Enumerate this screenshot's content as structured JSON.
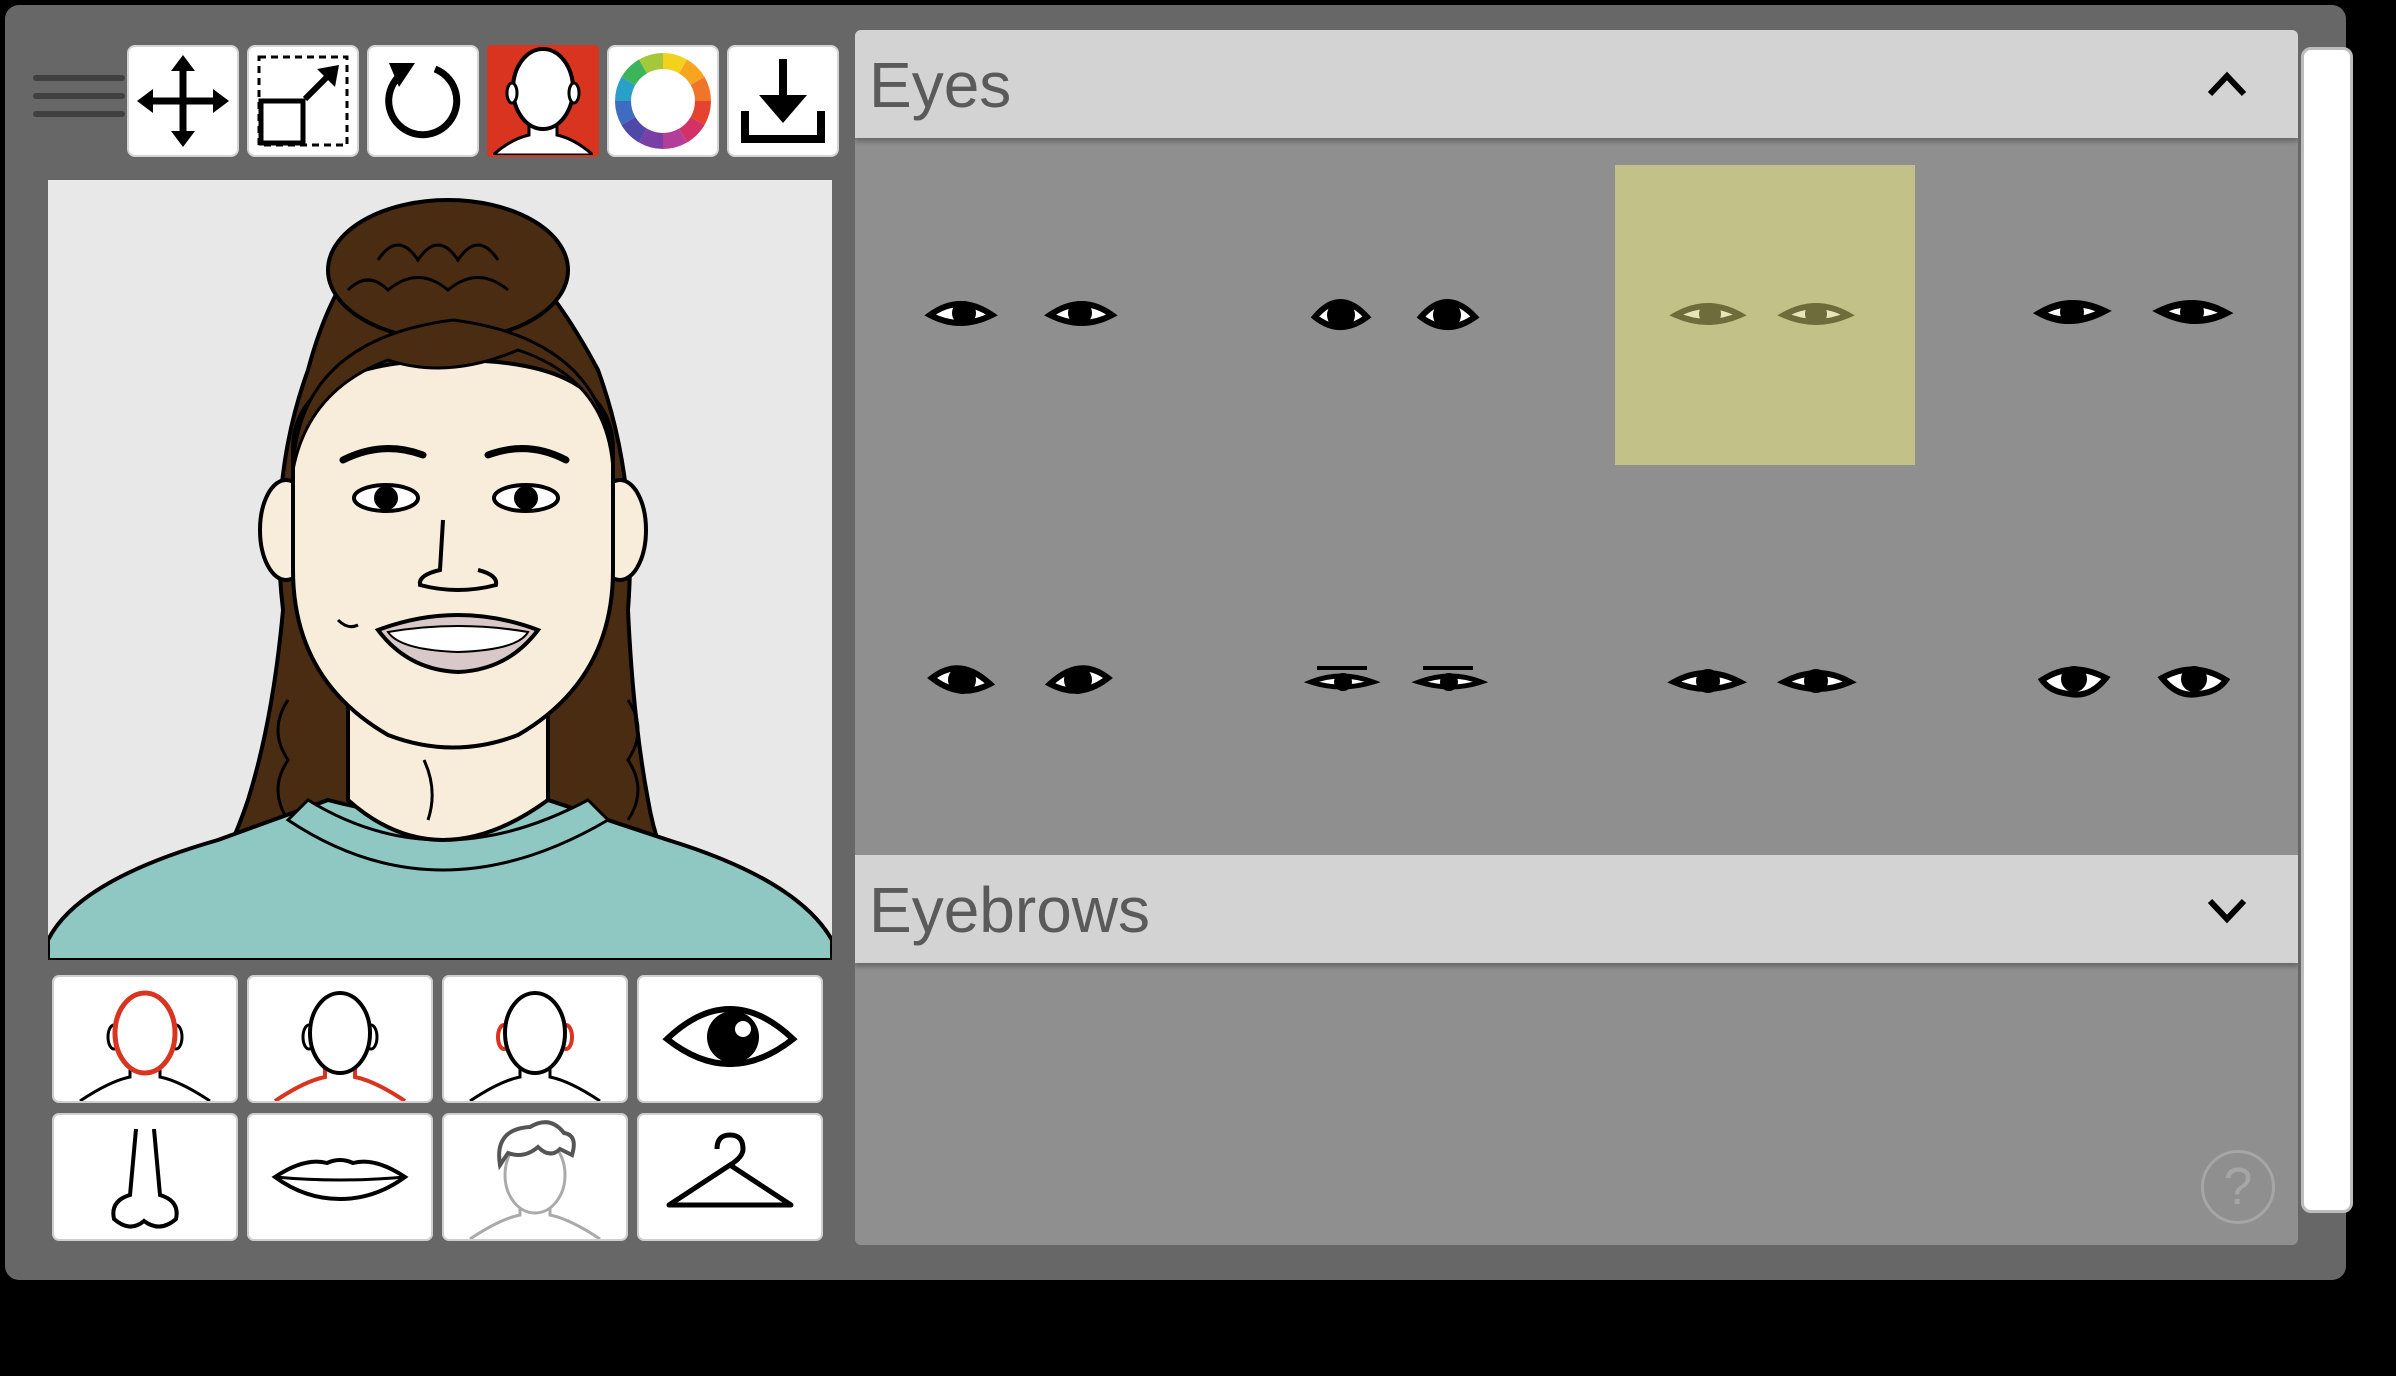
{
  "toolbar": {
    "buttons": [
      {
        "name": "move-tool-button",
        "icon": "move-arrows-icon"
      },
      {
        "name": "resize-tool-button",
        "icon": "resize-icon"
      },
      {
        "name": "reset-button",
        "icon": "reset-icon"
      },
      {
        "name": "face-shape-button",
        "icon": "head-icon",
        "active": true
      },
      {
        "name": "color-button",
        "icon": "color-wheel-icon"
      },
      {
        "name": "download-button",
        "icon": "download-icon"
      }
    ]
  },
  "categories": [
    {
      "name": "category-face",
      "icon": "face-outline-icon"
    },
    {
      "name": "category-neck",
      "icon": "neck-icon"
    },
    {
      "name": "category-ears",
      "icon": "ears-icon"
    },
    {
      "name": "category-eyes",
      "icon": "eye-icon"
    },
    {
      "name": "category-nose",
      "icon": "nose-icon"
    },
    {
      "name": "category-mouth",
      "icon": "lips-icon"
    },
    {
      "name": "category-hair",
      "icon": "hair-icon"
    },
    {
      "name": "category-clothing",
      "icon": "hanger-icon"
    }
  ],
  "sections": {
    "eyes": {
      "title": "Eyes",
      "expanded": true,
      "selected_index": 2,
      "option_count": 8
    },
    "eyebrows": {
      "title": "Eyebrows",
      "expanded": false
    }
  },
  "help": {
    "label": "?"
  },
  "colors": {
    "active_tool": "#d9341f",
    "selected_option": "#c1c188",
    "panel": "#8f8f8f",
    "header": "#d3d3d3",
    "hair": "#4a2c12",
    "skin": "#f8eddb",
    "sweater": "#8fc7c2"
  }
}
